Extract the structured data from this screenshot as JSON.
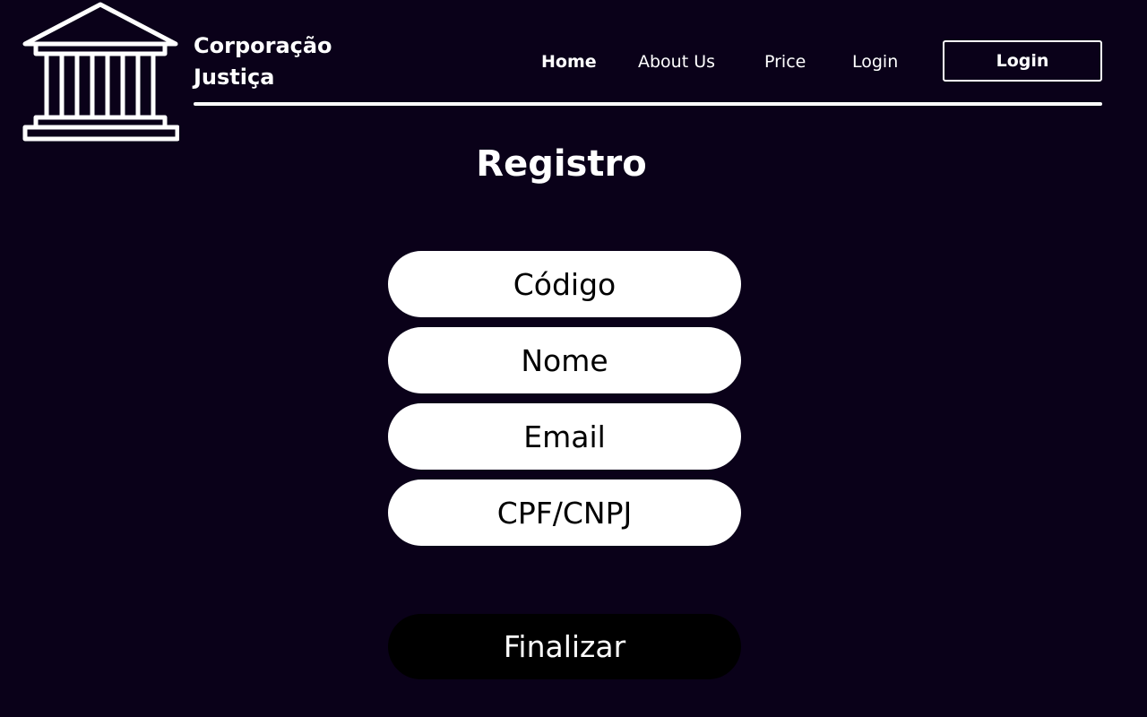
{
  "brand": {
    "line1": "Corporação",
    "line2": "Justiça",
    "logo_icon": "courthouse-icon"
  },
  "nav": {
    "items": [
      {
        "label": "Home",
        "active": true
      },
      {
        "label": "About Us",
        "active": false
      },
      {
        "label": "Price",
        "active": false
      },
      {
        "label": "Login",
        "active": false
      }
    ],
    "login_button_label": "Login"
  },
  "page": {
    "title": "Registro"
  },
  "form": {
    "fields": [
      {
        "placeholder": "Código",
        "value": ""
      },
      {
        "placeholder": "Nome",
        "value": ""
      },
      {
        "placeholder": "Email",
        "value": ""
      },
      {
        "placeholder": "CPF/CNPJ",
        "value": ""
      }
    ],
    "submit_label": "Finalizar"
  },
  "colors": {
    "background": "#0a0119",
    "foreground": "#ffffff",
    "field_background": "#ffffff",
    "field_text": "#000000",
    "submit_background": "#000000"
  }
}
